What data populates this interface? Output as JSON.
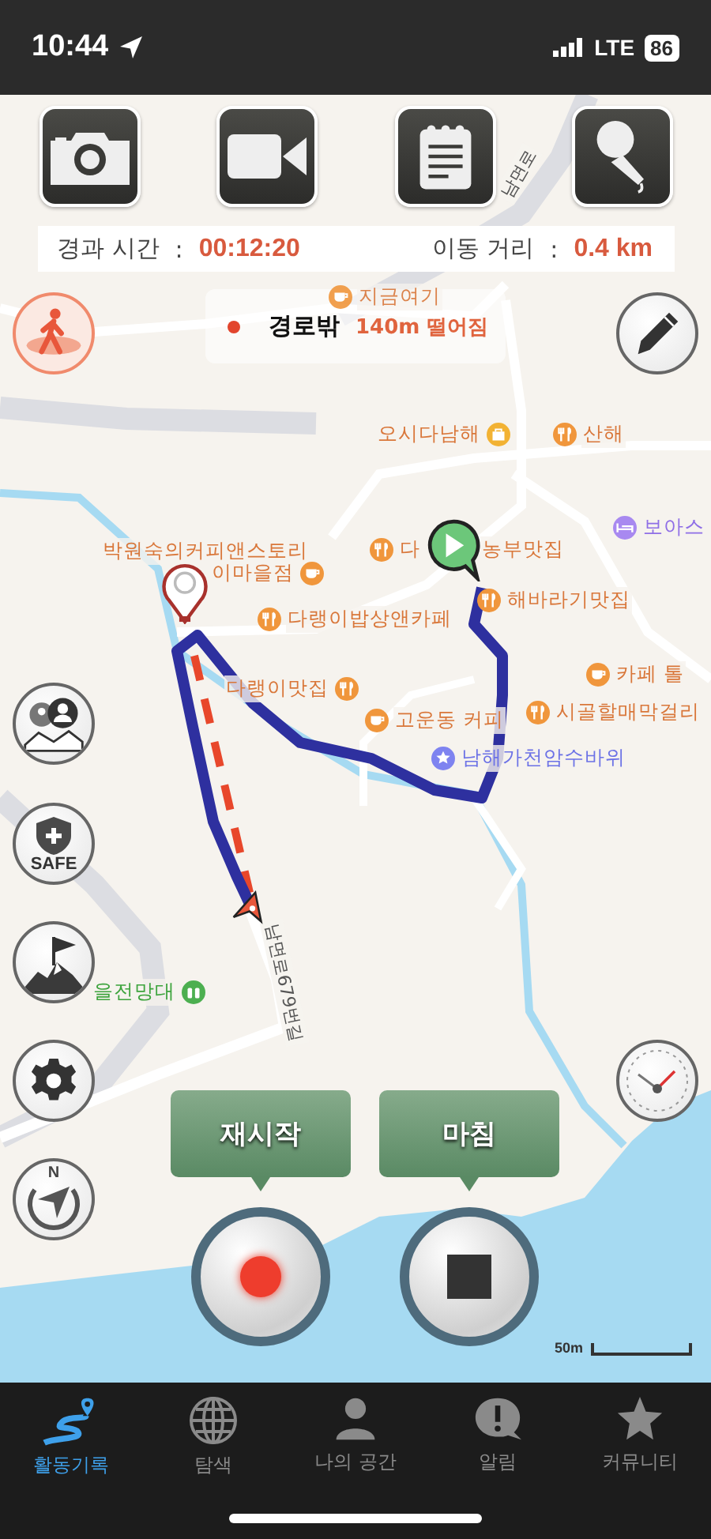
{
  "status_bar": {
    "time": "10:44",
    "network": "LTE",
    "battery": "86"
  },
  "toolbar": [
    {
      "kind": "camera"
    },
    {
      "kind": "video"
    },
    {
      "kind": "memo"
    },
    {
      "kind": "mic"
    }
  ],
  "stats": [
    {
      "label": "경과 시간",
      "separator": ":",
      "value": "00:12:20"
    },
    {
      "label": "이동 거리",
      "separator": ":",
      "value": "0.4 km"
    }
  ],
  "route_status": {
    "state": "경로밖",
    "detail": "140m 떨어짐"
  },
  "map": {
    "places": [
      {
        "name": "지금여기",
        "kind": "cafe",
        "faded": true
      },
      {
        "name": "오시다남해",
        "kind": "shop",
        "faded": false
      },
      {
        "name": "산해",
        "kind": "restaurant",
        "faded": false
      },
      {
        "name": "보아스",
        "kind": "lodging",
        "faded": false
      },
      {
        "name": "박원숙의커피앤스토리",
        "kind": "none",
        "faded": false
      },
      {
        "name": "이마을점",
        "kind": "cafe",
        "faded": false
      },
      {
        "name": "다",
        "kind": "restaurant",
        "faded": false
      },
      {
        "name": "농부맛집",
        "kind": "none",
        "faded": false
      },
      {
        "name": "해바라기맛집",
        "kind": "restaurant",
        "faded": false
      },
      {
        "name": "다랭이밥상앤카페",
        "kind": "restaurant",
        "faded": false
      },
      {
        "name": "다랭이맛집",
        "kind": "restaurant",
        "faded": false
      },
      {
        "name": "카페 톨",
        "kind": "cafe",
        "faded": false
      },
      {
        "name": "고운동 커피",
        "kind": "cafe",
        "faded": false
      },
      {
        "name": "시골할매막걸리",
        "kind": "restaurant",
        "faded": false
      },
      {
        "name": "남해가천암수바위",
        "kind": "attraction",
        "faded": false
      },
      {
        "name": "을전망대",
        "kind": "viewpoint",
        "faded": false
      }
    ],
    "roads": [
      "남면로",
      "남면로679번길"
    ],
    "scale": "50m"
  },
  "left_buttons": [
    {
      "kind": "walker"
    },
    {
      "kind": "community"
    },
    {
      "kind": "safe",
      "label": "SAFE"
    },
    {
      "kind": "summit"
    },
    {
      "kind": "settings"
    },
    {
      "kind": "compass",
      "label": "N"
    }
  ],
  "right_buttons": [
    {
      "kind": "pencil"
    },
    {
      "kind": "speedometer"
    }
  ],
  "actions": [
    {
      "label": "재시작",
      "kind": "record"
    },
    {
      "label": "마침",
      "kind": "stop"
    }
  ],
  "tabs": [
    {
      "label": "활동기록",
      "selected": true
    },
    {
      "label": "탐색",
      "selected": false
    },
    {
      "label": "나의 공간",
      "selected": false
    },
    {
      "label": "알림",
      "selected": false
    },
    {
      "label": "커뮤니티",
      "selected": false
    }
  ]
}
